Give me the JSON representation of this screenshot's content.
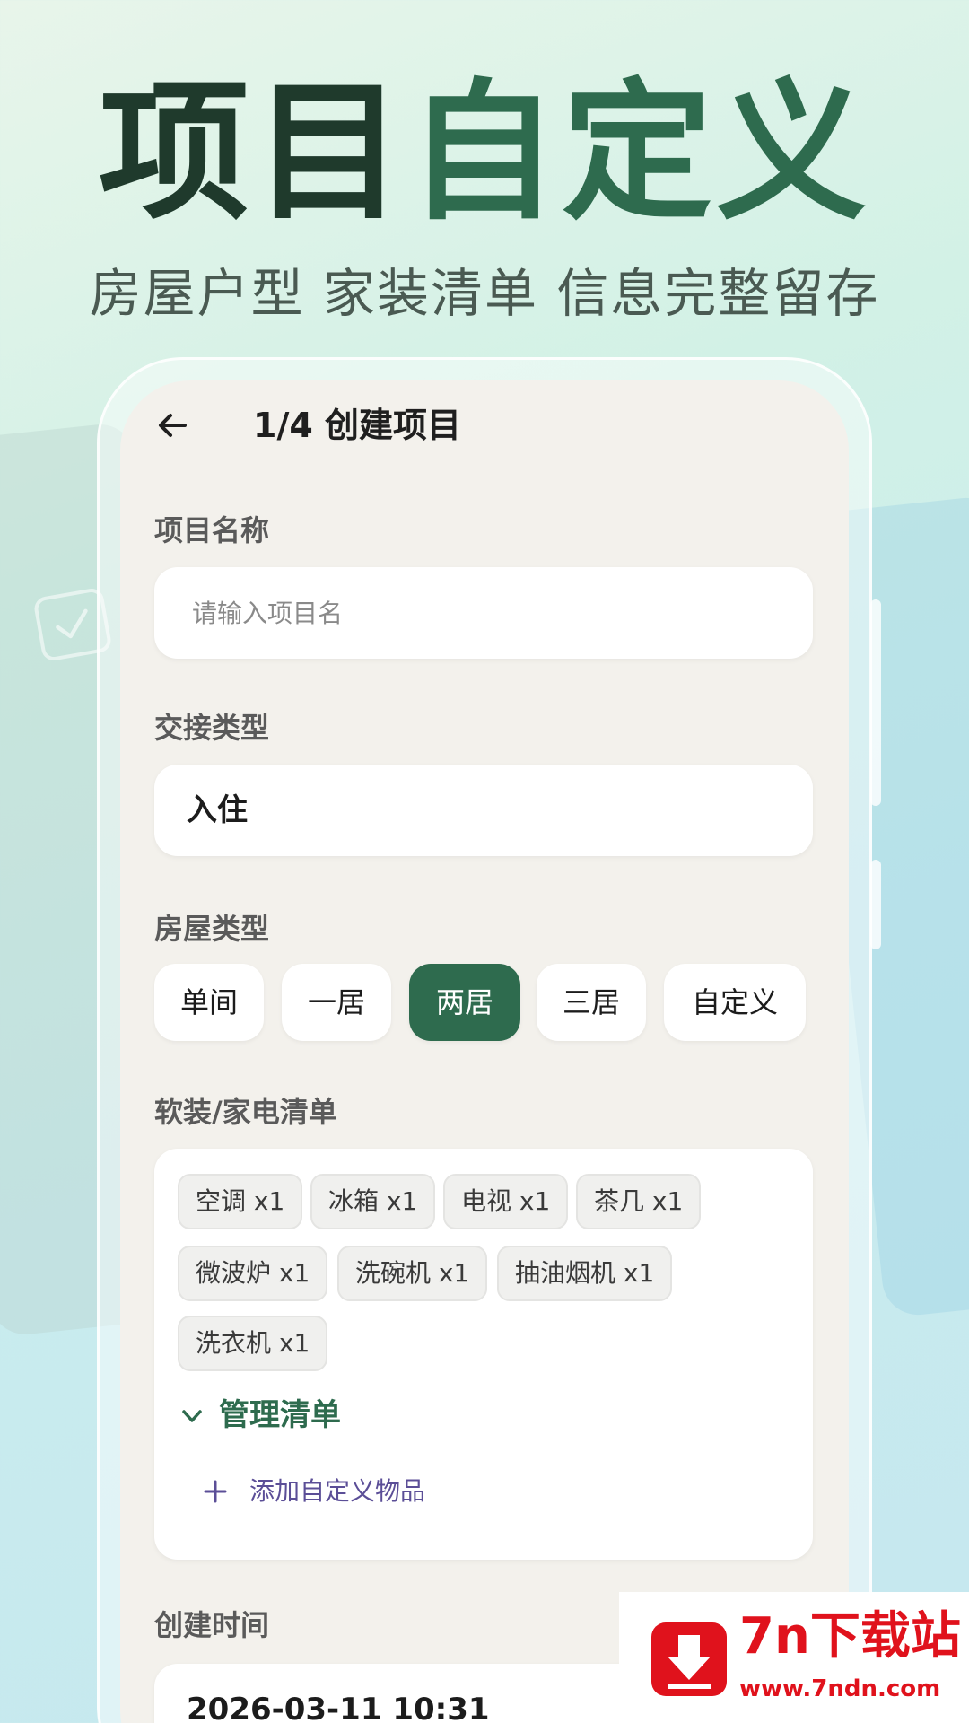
{
  "banner": {
    "headline_dark": "项目",
    "headline_green": "自定义",
    "subtitle": "房屋户型 家装清单 信息完整留存"
  },
  "appbar": {
    "title": "1/4 创建项目"
  },
  "form": {
    "project_name": {
      "label": "项目名称",
      "placeholder": "请输入项目名",
      "value": ""
    },
    "handover_type": {
      "label": "交接类型",
      "value": "入住"
    },
    "house_type": {
      "label": "房屋类型",
      "options": [
        "单间",
        "一居",
        "两居",
        "三居",
        "自定义"
      ],
      "selected": "两居"
    },
    "checklist": {
      "label": "软装/家电清单",
      "items": [
        "空调 x1",
        "冰箱 x1",
        "电视 x1",
        "茶几 x1",
        "微波炉 x1",
        "洗碗机 x1",
        "抽油烟机 x1",
        "洗衣机 x1"
      ],
      "manage_label": "管理清单",
      "add_label": "添加自定义物品"
    },
    "created_time": {
      "label": "创建时间",
      "value": "2026-03-11 10:31"
    }
  },
  "watermark": {
    "title": "7n下载站",
    "url": "www.7ndn.com"
  },
  "colors": {
    "brand_green": "#2e6b4e",
    "dark_green": "#1f3a2c",
    "link_purple": "#5b4e97",
    "watermark_red": "#e0121c"
  }
}
